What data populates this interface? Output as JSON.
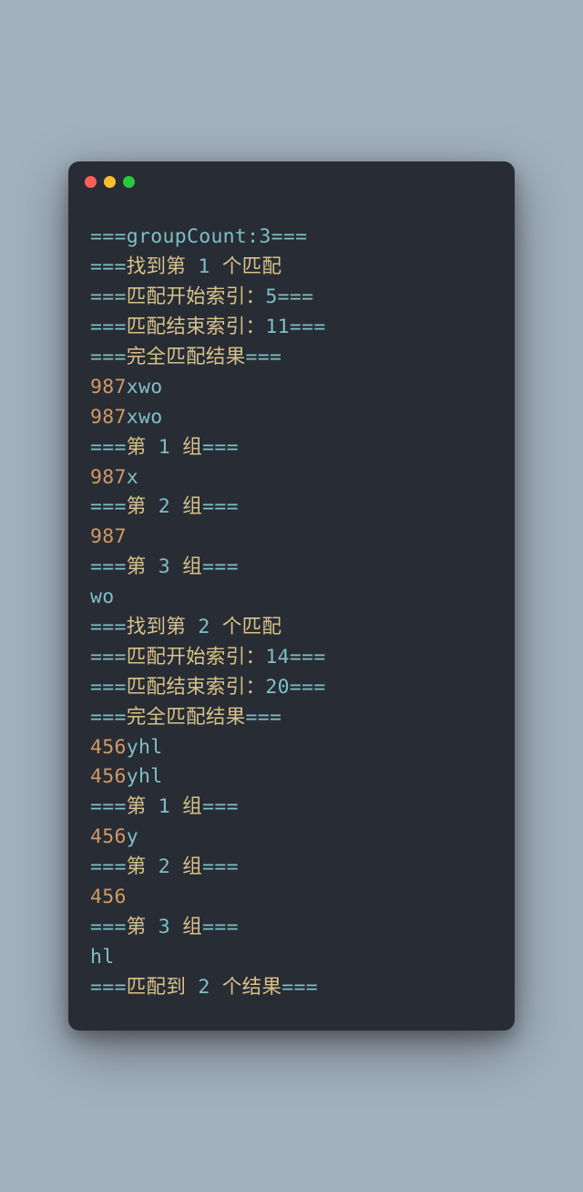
{
  "window": {
    "controls": [
      "close",
      "minimize",
      "zoom"
    ]
  },
  "lines": [
    {
      "segments": [
        {
          "text": "===groupCount:",
          "cls": "c-header"
        },
        {
          "text": "3",
          "cls": "c-num"
        },
        {
          "text": "===",
          "cls": "c-header"
        }
      ]
    },
    {
      "segments": [
        {
          "text": "===",
          "cls": "c-header"
        },
        {
          "text": "找到第 ",
          "cls": "c-text"
        },
        {
          "text": "1",
          "cls": "c-num"
        },
        {
          "text": " 个匹配",
          "cls": "c-text"
        }
      ]
    },
    {
      "segments": [
        {
          "text": "===",
          "cls": "c-header"
        },
        {
          "text": "匹配开始索引：",
          "cls": "c-text"
        },
        {
          "text": "5",
          "cls": "c-num"
        },
        {
          "text": "===",
          "cls": "c-header"
        }
      ]
    },
    {
      "segments": [
        {
          "text": "===",
          "cls": "c-header"
        },
        {
          "text": "匹配结束索引：",
          "cls": "c-text"
        },
        {
          "text": "11",
          "cls": "c-num"
        },
        {
          "text": "===",
          "cls": "c-header"
        }
      ]
    },
    {
      "segments": [
        {
          "text": "===",
          "cls": "c-header"
        },
        {
          "text": "完全匹配结果",
          "cls": "c-text"
        },
        {
          "text": "===",
          "cls": "c-header"
        }
      ]
    },
    {
      "segments": [
        {
          "text": "987",
          "cls": "c-value"
        },
        {
          "text": "xwo",
          "cls": "c-header"
        }
      ]
    },
    {
      "segments": [
        {
          "text": "987",
          "cls": "c-value"
        },
        {
          "text": "xwo",
          "cls": "c-header"
        }
      ]
    },
    {
      "segments": [
        {
          "text": "===",
          "cls": "c-header"
        },
        {
          "text": "第 ",
          "cls": "c-text"
        },
        {
          "text": "1",
          "cls": "c-num"
        },
        {
          "text": " 组",
          "cls": "c-text"
        },
        {
          "text": "===",
          "cls": "c-header"
        }
      ]
    },
    {
      "segments": [
        {
          "text": "987",
          "cls": "c-value"
        },
        {
          "text": "x",
          "cls": "c-header"
        }
      ]
    },
    {
      "segments": [
        {
          "text": "===",
          "cls": "c-header"
        },
        {
          "text": "第 ",
          "cls": "c-text"
        },
        {
          "text": "2",
          "cls": "c-num"
        },
        {
          "text": " 组",
          "cls": "c-text"
        },
        {
          "text": "===",
          "cls": "c-header"
        }
      ]
    },
    {
      "segments": [
        {
          "text": "987",
          "cls": "c-value"
        }
      ]
    },
    {
      "segments": [
        {
          "text": "===",
          "cls": "c-header"
        },
        {
          "text": "第 ",
          "cls": "c-text"
        },
        {
          "text": "3",
          "cls": "c-num"
        },
        {
          "text": " 组",
          "cls": "c-text"
        },
        {
          "text": "===",
          "cls": "c-header"
        }
      ]
    },
    {
      "segments": [
        {
          "text": "wo",
          "cls": "c-header"
        }
      ]
    },
    {
      "segments": [
        {
          "text": "===",
          "cls": "c-header"
        },
        {
          "text": "找到第 ",
          "cls": "c-text"
        },
        {
          "text": "2",
          "cls": "c-num"
        },
        {
          "text": " 个匹配",
          "cls": "c-text"
        }
      ]
    },
    {
      "segments": [
        {
          "text": "===",
          "cls": "c-header"
        },
        {
          "text": "匹配开始索引：",
          "cls": "c-text"
        },
        {
          "text": "14",
          "cls": "c-num"
        },
        {
          "text": "===",
          "cls": "c-header"
        }
      ]
    },
    {
      "segments": [
        {
          "text": "===",
          "cls": "c-header"
        },
        {
          "text": "匹配结束索引：",
          "cls": "c-text"
        },
        {
          "text": "20",
          "cls": "c-num"
        },
        {
          "text": "===",
          "cls": "c-header"
        }
      ]
    },
    {
      "segments": [
        {
          "text": "===",
          "cls": "c-header"
        },
        {
          "text": "完全匹配结果",
          "cls": "c-text"
        },
        {
          "text": "===",
          "cls": "c-header"
        }
      ]
    },
    {
      "segments": [
        {
          "text": "456",
          "cls": "c-value"
        },
        {
          "text": "yhl",
          "cls": "c-header"
        }
      ]
    },
    {
      "segments": [
        {
          "text": "456",
          "cls": "c-value"
        },
        {
          "text": "yhl",
          "cls": "c-header"
        }
      ]
    },
    {
      "segments": [
        {
          "text": "===",
          "cls": "c-header"
        },
        {
          "text": "第 ",
          "cls": "c-text"
        },
        {
          "text": "1",
          "cls": "c-num"
        },
        {
          "text": " 组",
          "cls": "c-text"
        },
        {
          "text": "===",
          "cls": "c-header"
        }
      ]
    },
    {
      "segments": [
        {
          "text": "456",
          "cls": "c-value"
        },
        {
          "text": "y",
          "cls": "c-header"
        }
      ]
    },
    {
      "segments": [
        {
          "text": "===",
          "cls": "c-header"
        },
        {
          "text": "第 ",
          "cls": "c-text"
        },
        {
          "text": "2",
          "cls": "c-num"
        },
        {
          "text": " 组",
          "cls": "c-text"
        },
        {
          "text": "===",
          "cls": "c-header"
        }
      ]
    },
    {
      "segments": [
        {
          "text": "456",
          "cls": "c-value"
        }
      ]
    },
    {
      "segments": [
        {
          "text": "===",
          "cls": "c-header"
        },
        {
          "text": "第 ",
          "cls": "c-text"
        },
        {
          "text": "3",
          "cls": "c-num"
        },
        {
          "text": " 组",
          "cls": "c-text"
        },
        {
          "text": "===",
          "cls": "c-header"
        }
      ]
    },
    {
      "segments": [
        {
          "text": "hl",
          "cls": "c-header"
        }
      ]
    },
    {
      "segments": [
        {
          "text": "===",
          "cls": "c-header"
        },
        {
          "text": "匹配到 ",
          "cls": "c-text"
        },
        {
          "text": "2",
          "cls": "c-num"
        },
        {
          "text": " 个结果",
          "cls": "c-text"
        },
        {
          "text": "===",
          "cls": "c-header"
        }
      ]
    }
  ]
}
